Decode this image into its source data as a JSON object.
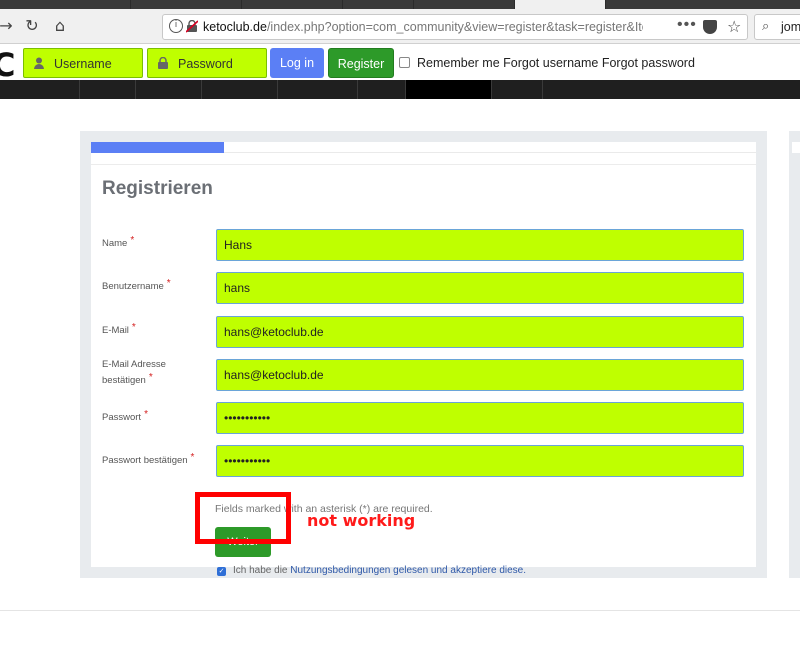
{
  "browser": {
    "url_prefix": "ketoclub.de",
    "url_rest": "/index.php?option=com_community&view=register&task=register&Itemid",
    "overflow_menu": "•••",
    "search_value": "joms",
    "search_icon": "⌕",
    "back_icon": "→",
    "reload_icon": "↻",
    "home_icon": "⌂",
    "info_icon": "i",
    "star_icon": "☆"
  },
  "loginbar": {
    "logo_fragment": "C",
    "username_placeholder": "Username",
    "password_placeholder": "Password",
    "login_label": "Log in",
    "register_label": "Register",
    "remember_label": "Remember me",
    "forgot_username": "Forgot username",
    "forgot_password": "Forgot password"
  },
  "colors": {
    "field_bg": "#bfff00",
    "login_btn": "#5b7ff5",
    "register_btn": "#2d9a29",
    "progress": "#5b7ff5",
    "annotation": "#ff0000"
  },
  "progress": {
    "fraction": 0.2
  },
  "form": {
    "title": "Registrieren",
    "required_marker": "*",
    "fields": [
      {
        "label": "Name",
        "value": "Hans"
      },
      {
        "label": "Benutzername",
        "value": "hans"
      },
      {
        "label": "E-Mail",
        "value": "hans@ketoclub.de"
      },
      {
        "label": "E-Mail Adresse bestätigen",
        "value": "hans@ketoclub.de"
      },
      {
        "label": "Passwort",
        "value": "•••••••••••"
      },
      {
        "label": "Passwort bestätigen",
        "value": "•••••••••••"
      }
    ],
    "required_note": "Fields marked with an asterisk (*) are required.",
    "submit_label": "Weiter",
    "terms_prefix": "Ich habe die ",
    "terms_link": "Nutzungsbedingungen gelesen und akzeptiere diese.",
    "terms_checkmark": "✓"
  },
  "annotation": {
    "text": "not working"
  }
}
